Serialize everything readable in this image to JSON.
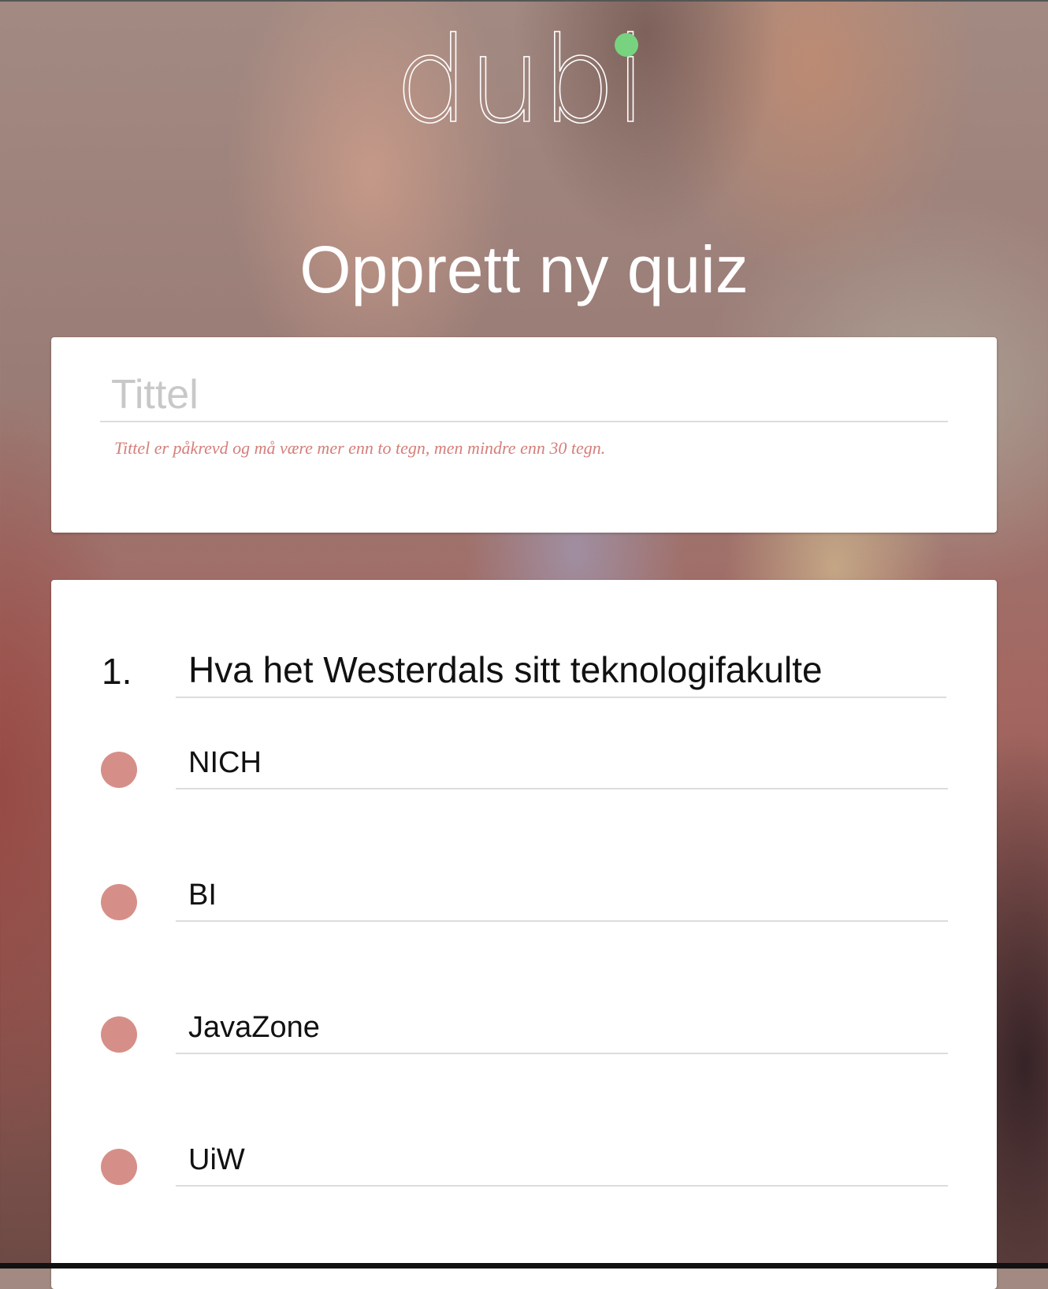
{
  "app": {
    "logo_text": "dubi",
    "logo_dot_color": "#77d37f"
  },
  "header": {
    "title": "Opprett ny quiz"
  },
  "title_form": {
    "placeholder": "Tittel",
    "value": "",
    "error": "Tittel er påkrevd og må være mer enn to tegn, men mindre enn 30 tegn."
  },
  "question": {
    "number": "1.",
    "text": "Hva het Westerdals sitt teknologifakulte",
    "answers": [
      {
        "label": "NICH"
      },
      {
        "label": "BI"
      },
      {
        "label": "JavaZone"
      },
      {
        "label": "UiW"
      }
    ]
  },
  "colors": {
    "answer_dot": "#d68f88",
    "error": "#d47f7b"
  }
}
